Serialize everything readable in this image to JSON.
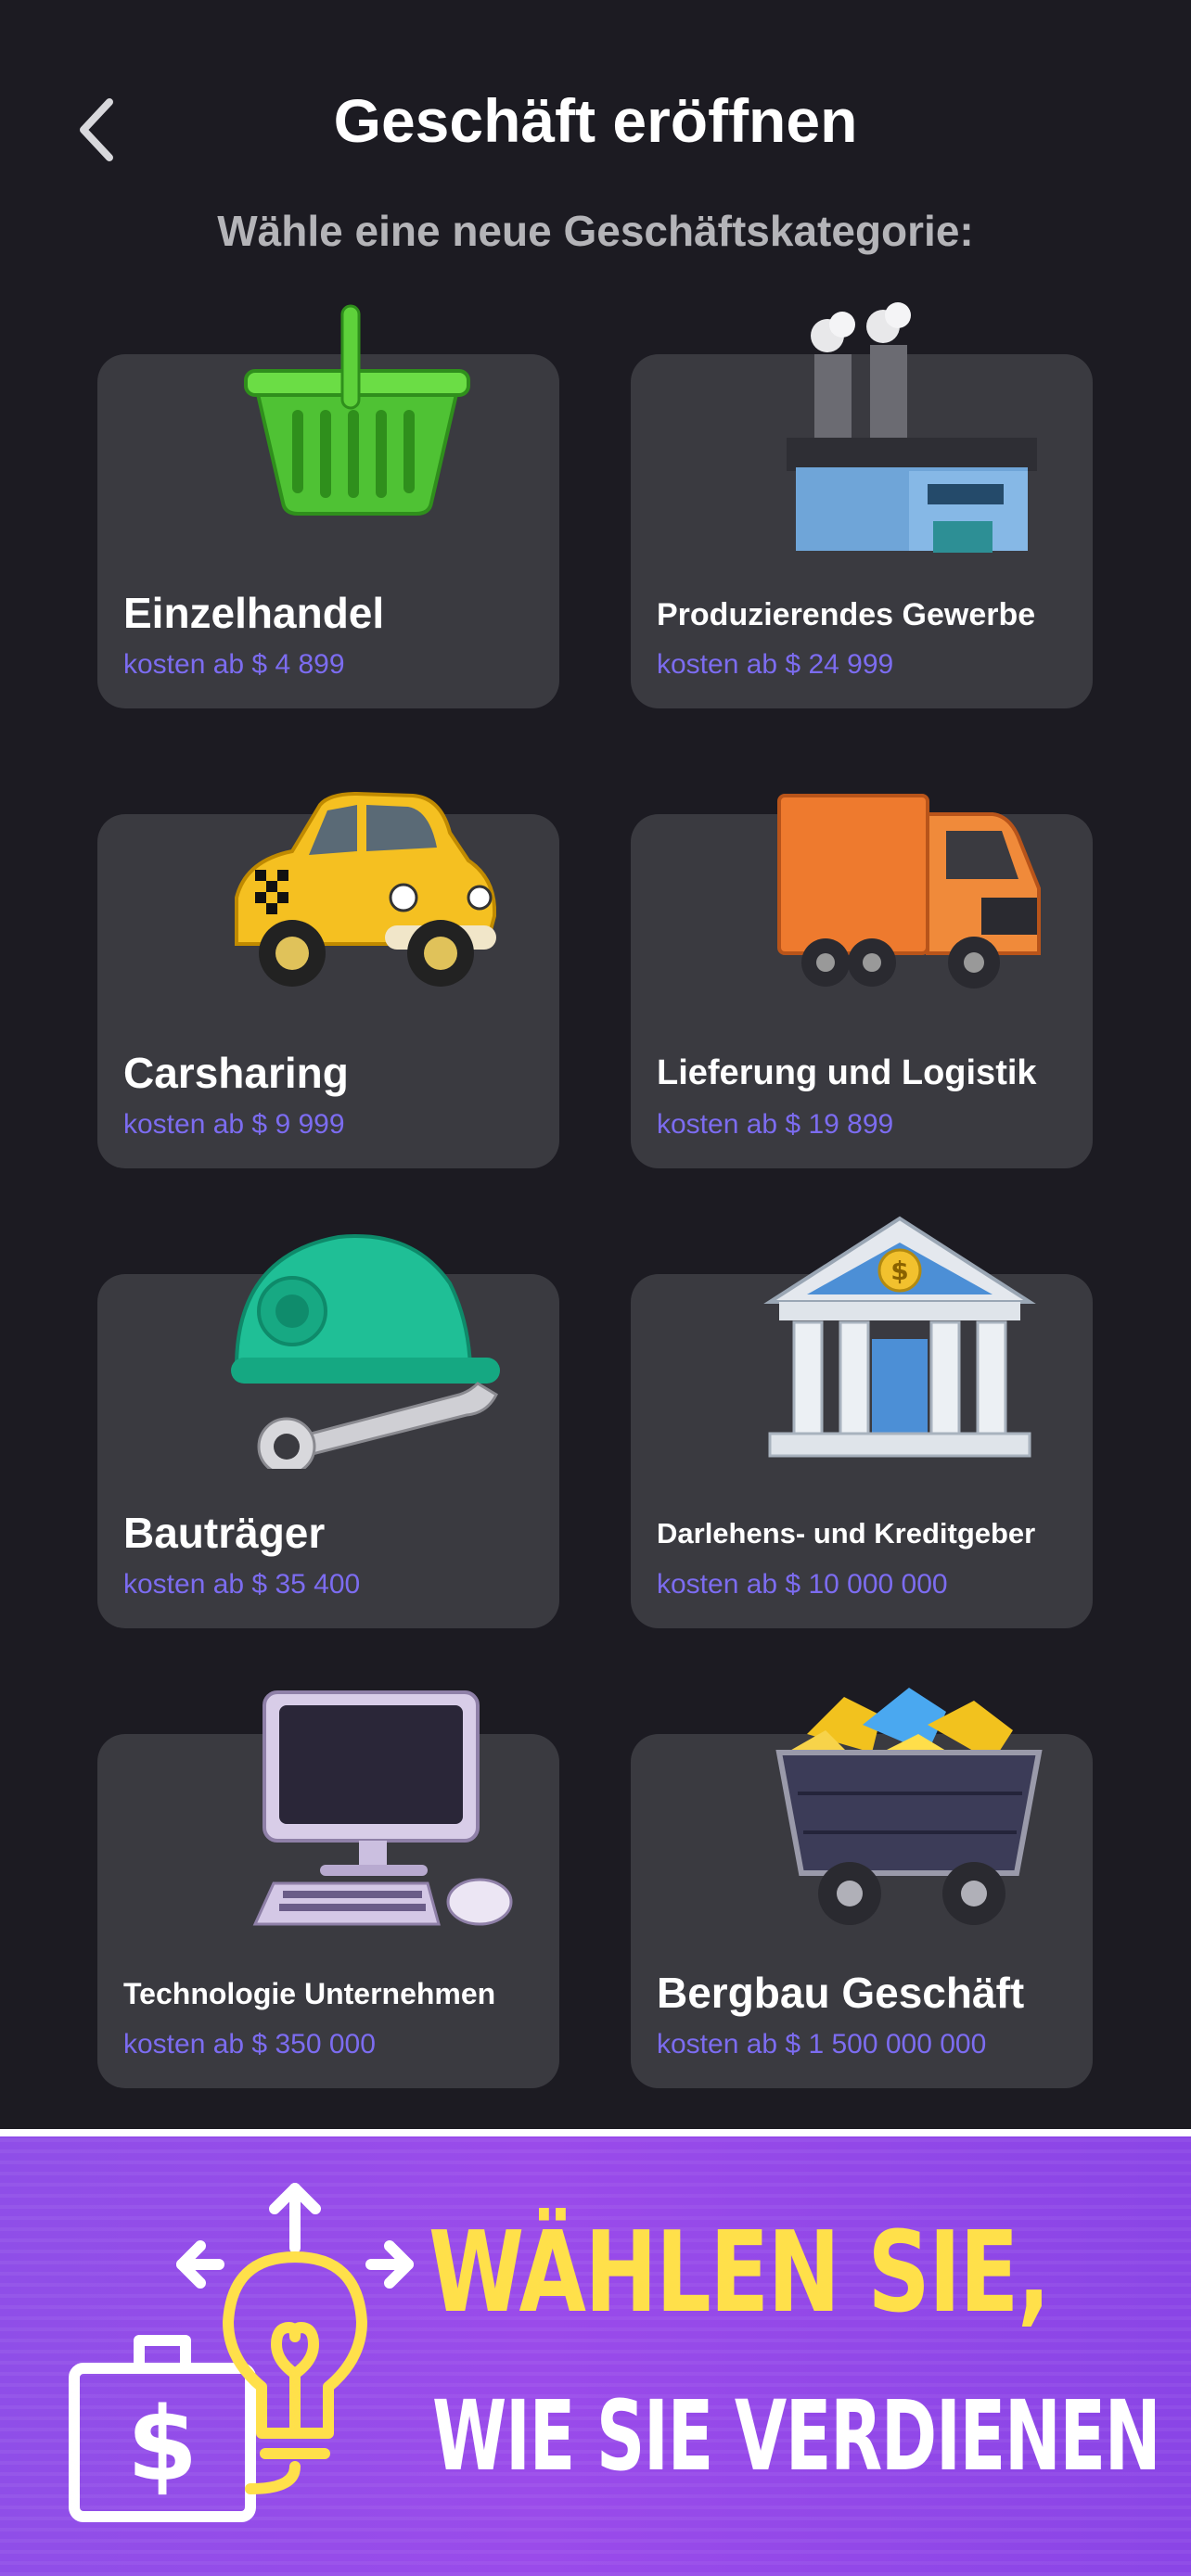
{
  "header": {
    "title": "Geschäft eröffnen",
    "subtitle": "Wähle eine neue Geschäftskategorie:"
  },
  "categories": [
    {
      "name": "Einzelhandel",
      "price": "kosten ab $ 4 899",
      "icon": "shopping-basket-icon"
    },
    {
      "name": "Produzierendes Gewerbe",
      "price": "kosten ab $ 24 999",
      "icon": "factory-icon"
    },
    {
      "name": "Carsharing",
      "price": "kosten ab $ 9 999",
      "icon": "taxi-car-icon"
    },
    {
      "name": "Lieferung und Logistik",
      "price": "kosten ab $ 19 899",
      "icon": "delivery-truck-icon"
    },
    {
      "name": "Bauträger",
      "price": "kosten ab $ 35 400",
      "icon": "hard-hat-wrench-icon"
    },
    {
      "name": "Darlehens- und Kreditgeber",
      "price": "kosten ab $ 10 000 000",
      "icon": "bank-building-icon"
    },
    {
      "name": "Technologie Unternehmen",
      "price": "kosten ab $ 350 000",
      "icon": "computer-icon"
    },
    {
      "name": "Bergbau Geschäft",
      "price": "kosten ab $ 1 500 000 000",
      "icon": "mine-cart-icon"
    }
  ],
  "banner": {
    "line1": "WÄHLEN SIE,",
    "line2": "WIE SIE VERDIENEN",
    "icon": "money-bag-lightbulb-icon"
  },
  "colors": {
    "background": "#1c1b22",
    "card": "#3a3a40",
    "price": "#7c6cf0",
    "banner_purple": "#9a4bea",
    "banner_yellow": "#ffe04a"
  }
}
